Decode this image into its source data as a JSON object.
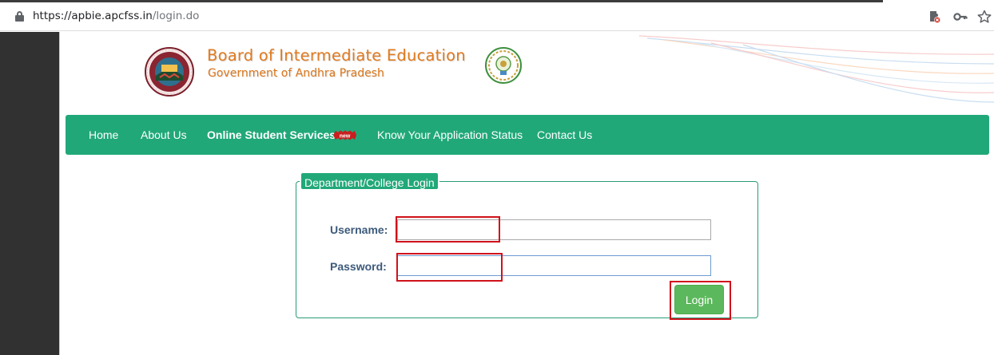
{
  "browser": {
    "url_host": "https://apbie.apcfss.in",
    "url_path": "/login.do",
    "icons": [
      "lock-icon",
      "blocked-extension-icon",
      "key-icon",
      "star-icon"
    ]
  },
  "header": {
    "title": "Board of Intermediate Education",
    "subtitle": "Government of Andhra Pradesh",
    "logos": [
      "board-seal-logo",
      "ap-government-emblem"
    ]
  },
  "nav": {
    "items": [
      {
        "label": "Home"
      },
      {
        "label": "About Us"
      },
      {
        "label": "Online Student Services",
        "badge": "new"
      },
      {
        "label": "Know Your Application Status"
      },
      {
        "label": "Contact Us"
      }
    ]
  },
  "login": {
    "legend": "Department/College Login",
    "username_label": "Username:",
    "username_value": "",
    "password_label": "Password:",
    "password_value": "",
    "submit_label": "Login"
  },
  "colors": {
    "nav_bg": "#21a879",
    "title_orange": "#e07b21",
    "login_button": "#5cb85c",
    "highlight_red": "#d0121b"
  }
}
